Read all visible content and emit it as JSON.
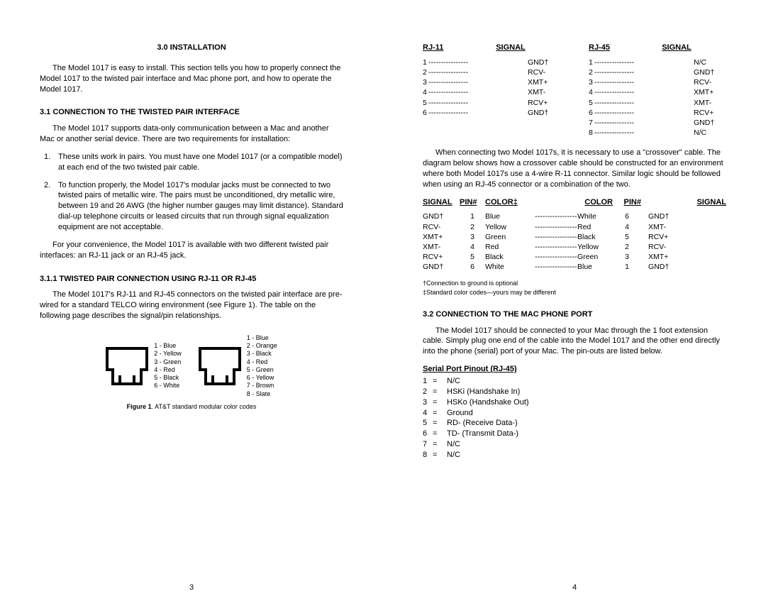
{
  "left": {
    "h_installation": "3.0  INSTALLATION",
    "p1": "The Model 1017 is easy to install.  This section tells you how to properly connect the Model 1017 to the twisted pair interface and Mac phone port, and how to operate the Model 1017.",
    "h_conn_tp": "3.1  CONNECTION TO THE TWISTED PAIR INTERFACE",
    "p2": "The Model 1017 supports data-only communication between a Mac and another Mac or another serial device.  There are two requirements for installation:",
    "li1_num": "1.",
    "li1": "These units work in pairs.  You must have one Model 1017 (or a compatible model) at each end of the two twisted pair cable.",
    "li2_num": "2.",
    "li2": "To function properly, the Model 1017's modular jacks must be connected to two twisted pairs of metallic wire.  The pairs must be unconditioned, dry metallic wire, between 19 and 26 AWG (the higher number gauges may limit distance).  Standard dial-up telephone circuits or leased circuits that run through signal equalization equipment are not acceptable.",
    "p3": "For your convenience, the Model 1017 is available with two different twisted pair interfaces:  an RJ-11 jack or an RJ-45 jack.",
    "h_rj": "3.1.1  TWISTED PAIR CONNECTION USING RJ-11 OR RJ-45",
    "p4": "The Model 1017's RJ-11 and RJ-45 connectors on the twisted pair interface are pre-wired for a standard TELCO wiring environment (see Figure 1).  The table on the following page describes the signal/pin relationships.",
    "jack6": [
      "1 - Blue",
      "2 - Yellow",
      "3 - Green",
      "4 - Red",
      "5 - Black",
      "6 - White"
    ],
    "jack8": [
      "1 - Blue",
      "2 - Orange",
      "3 - Black",
      "4 - Red",
      "5 - Green",
      "6 - Yellow",
      "7 - Brown",
      "8 - Slate"
    ],
    "fig_b": "Figure 1",
    "fig_t": ".  AT&T standard modular color codes",
    "pagenum": "3"
  },
  "right": {
    "rj11_h1": "RJ-11",
    "rj11_h2": "SIGNAL",
    "rj45_h1": "RJ-45",
    "rj45_h2": "SIGNAL",
    "rj11_rows": [
      {
        "p": "1",
        "s": "GND†"
      },
      {
        "p": "2",
        "s": "RCV-"
      },
      {
        "p": "3",
        "s": "XMT+"
      },
      {
        "p": "4",
        "s": "XMT-"
      },
      {
        "p": "5",
        "s": "RCV+"
      },
      {
        "p": "6",
        "s": "GND†"
      }
    ],
    "rj45_rows": [
      {
        "p": "1",
        "s": "N/C"
      },
      {
        "p": "2",
        "s": "GND†"
      },
      {
        "p": "3",
        "s": "RCV-"
      },
      {
        "p": "4",
        "s": "XMT+"
      },
      {
        "p": "5",
        "s": "XMT-"
      },
      {
        "p": "6",
        "s": "RCV+"
      },
      {
        "p": "7",
        "s": "GND†"
      },
      {
        "p": "8",
        "s": "N/C"
      }
    ],
    "p_cross": "When connecting two Model 1017s, it is necessary to use a \"crossover\" cable.  The diagram below shows how a crossover cable should be constructed for an environment where both Model 1017s use a 4-wire R-11 connector.  Similar logic should be followed when using an RJ-45 connector or a combination of the two.",
    "xh": {
      "signal": "SIGNAL",
      "pin": "PIN#",
      "color": "COLOR‡",
      "color2": "COLOR",
      "pin2": "PIN#",
      "signal2": "SIGNAL"
    },
    "xrows": [
      {
        "s": "GND†",
        "p": "1",
        "c1": "Blue",
        "c2": "White",
        "p2": "6",
        "s2": "GND†"
      },
      {
        "s": "RCV-",
        "p": "2",
        "c1": "Yellow",
        "c2": "Red",
        "p2": "4",
        "s2": "XMT-"
      },
      {
        "s": "XMT+",
        "p": "3",
        "c1": "Green",
        "c2": "Black",
        "p2": "5",
        "s2": "RCV+"
      },
      {
        "s": "XMT-",
        "p": "4",
        "c1": "Red",
        "c2": "Yellow",
        "p2": "2",
        "s2": "RCV-"
      },
      {
        "s": "RCV+",
        "p": "5",
        "c1": "Black",
        "c2": "Green",
        "p2": "3",
        "s2": "XMT+"
      },
      {
        "s": "GND†",
        "p": "6",
        "c1": "White",
        "c2": "Blue",
        "p2": "1",
        "s2": "GND†"
      }
    ],
    "foot1": "†Connection to ground is optional",
    "foot2": "‡Standard color codes—yours may be different",
    "h_mac": "3.2  CONNECTION TO THE MAC PHONE PORT",
    "p_mac": "The Model 1017 should be connected to your Mac through the 1 foot extension cable.  Simply plug one end of the cable into the Model 1017 and the other end directly into the phone (serial) port of your Mac.  The pin-outs are listed below.",
    "serial_h": "Serial Port Pinout (RJ-45)",
    "serial": [
      {
        "p": "1",
        "v": "N/C"
      },
      {
        "p": "2",
        "v": "HSKi (Handshake In)"
      },
      {
        "p": "3",
        "v": "HSKo (Handshake Out)"
      },
      {
        "p": "4",
        "v": "Ground"
      },
      {
        "p": "5",
        "v": "RD- (Receive Data-)"
      },
      {
        "p": "6",
        "v": "TD- (Transmit Data-)"
      },
      {
        "p": "7",
        "v": "N/C"
      },
      {
        "p": "8",
        "v": "N/C"
      }
    ],
    "pagenum": "4"
  },
  "dash": "----------------",
  "dash2": "---------------------"
}
